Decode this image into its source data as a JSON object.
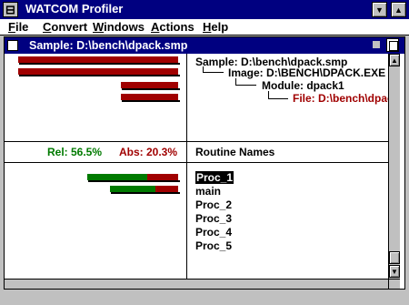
{
  "app": {
    "title": "WATCOM Profiler"
  },
  "menu": [
    {
      "label": "File",
      "accel": "F",
      "rest": "ile"
    },
    {
      "label": "Convert",
      "accel": "C",
      "rest": "onvert"
    },
    {
      "label": "Windows",
      "accel": "W",
      "rest": "indows"
    },
    {
      "label": "Actions",
      "accel": "A",
      "rest": "ctions"
    },
    {
      "label": "Help",
      "accel": "H",
      "rest": "elp"
    }
  ],
  "child_window": {
    "title": "Sample:  D:\\bench\\dpack.smp"
  },
  "tree": {
    "sample": "Sample:  D:\\bench\\dpack.smp",
    "image": "Image:  D:\\BENCH\\DPACK.EXE",
    "module": "Module:  dpack1",
    "file": "File:  D:\\bench\\dpack.c"
  },
  "stats": {
    "rel": "Rel:  56.5%",
    "abs": "Abs:  20.3%",
    "header": "Routine Names"
  },
  "routines": [
    "Proc_1",
    "main",
    "Proc_2",
    "Proc_3",
    "Proc_4",
    "Proc_5"
  ],
  "colors": {
    "title_bar": "#000080",
    "rel": "#007a00",
    "abs": "#a00000",
    "file_text": "#a00000",
    "selection": "#000000"
  }
}
